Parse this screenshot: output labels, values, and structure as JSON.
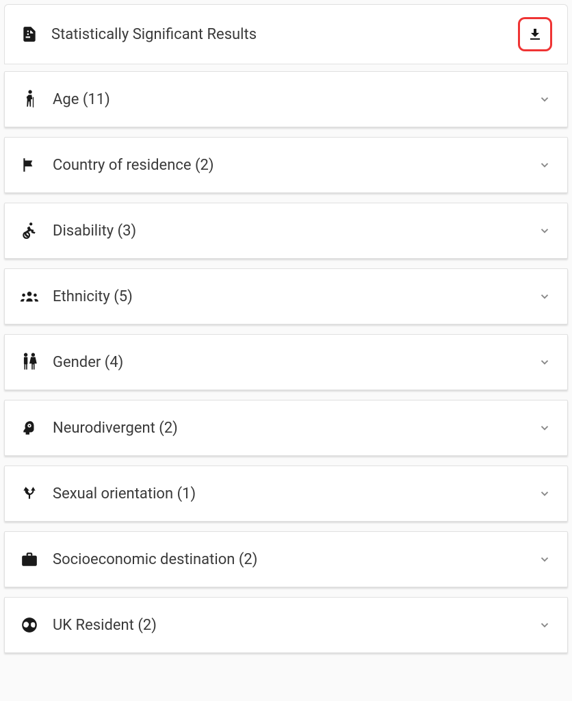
{
  "header": {
    "title": "Statistically Significant Results"
  },
  "categories": [
    {
      "label": "Age",
      "count": 11,
      "icon": "person-cane"
    },
    {
      "label": "Country of residence",
      "count": 2,
      "icon": "flag"
    },
    {
      "label": "Disability",
      "count": 3,
      "icon": "wheelchair"
    },
    {
      "label": "Ethnicity",
      "count": 5,
      "icon": "groups"
    },
    {
      "label": "Gender",
      "count": 4,
      "icon": "people"
    },
    {
      "label": "Neurodivergent",
      "count": 2,
      "icon": "head-cog"
    },
    {
      "label": "Sexual orientation",
      "count": 1,
      "icon": "branch"
    },
    {
      "label": "Socioeconomic destination",
      "count": 2,
      "icon": "briefcase"
    },
    {
      "label": "UK Resident",
      "count": 2,
      "icon": "globe"
    }
  ]
}
